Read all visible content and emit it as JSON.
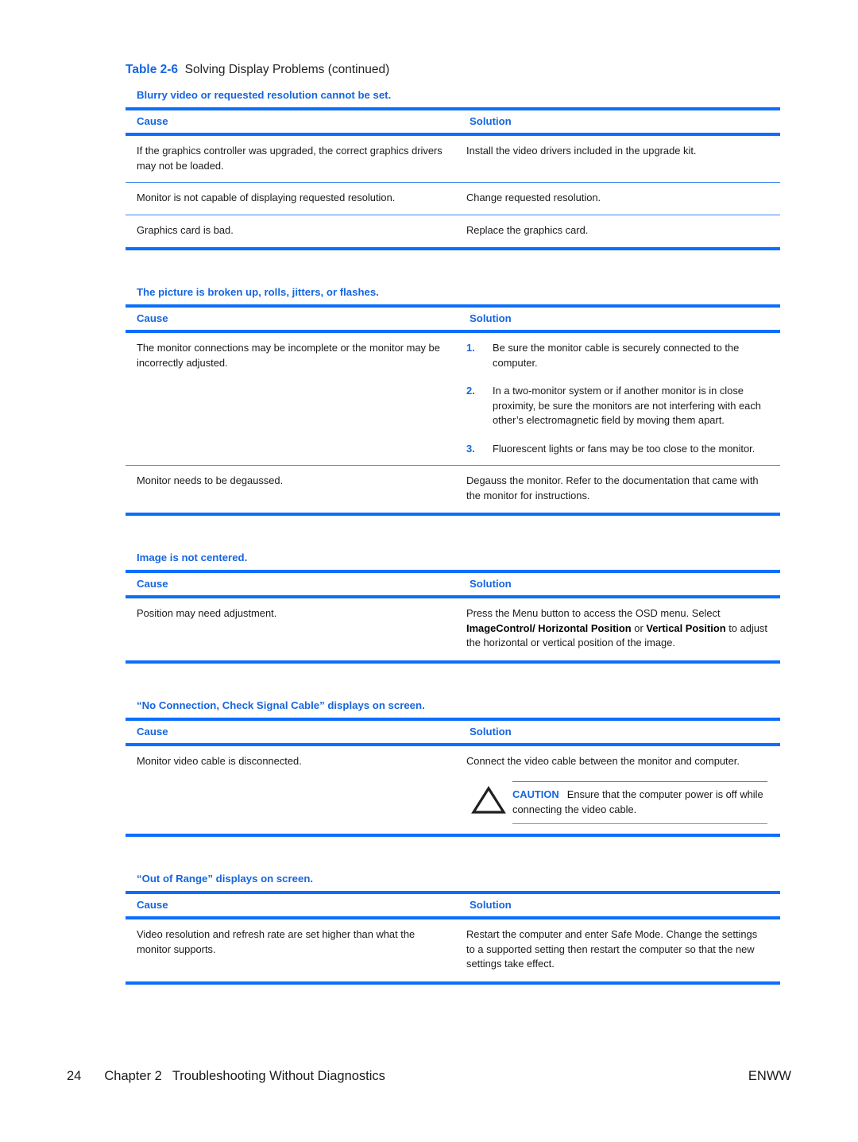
{
  "document": {
    "table_caption": {
      "number": "Table 2-6",
      "text": "Solving Display Problems (continued)"
    },
    "column_headers": {
      "cause": "Cause",
      "solution": "Solution"
    },
    "sections": [
      {
        "title": "Blurry video or requested resolution cannot be set.",
        "rows": [
          {
            "cause": "If the graphics controller was upgraded, the correct graphics drivers may not be loaded.",
            "solution": "Install the video drivers included in the upgrade kit."
          },
          {
            "cause": "Monitor is not capable of displaying requested resolution.",
            "solution": "Change requested resolution."
          },
          {
            "cause": "Graphics card is bad.",
            "solution": "Replace the graphics card."
          }
        ]
      },
      {
        "title": "The picture is broken up, rolls, jitters, or flashes.",
        "rows": [
          {
            "cause": "The monitor connections may be incomplete or the monitor may be incorrectly adjusted.",
            "solution_steps": [
              {
                "num": "1.",
                "text": "Be sure the monitor cable is securely connected to the computer."
              },
              {
                "num": "2.",
                "text": "In a two-monitor system or if another monitor is in close proximity, be sure the monitors are not interfering with each other’s electromagnetic field by moving them apart."
              },
              {
                "num": "3.",
                "text": "Fluorescent lights or fans may be too close to the monitor."
              }
            ]
          },
          {
            "cause": "Monitor needs to be degaussed.",
            "solution": "Degauss the monitor. Refer to the documentation that came with the monitor for instructions."
          }
        ]
      },
      {
        "title": "Image is not centered.",
        "rows": [
          {
            "cause": "Position may need adjustment.",
            "solution_rich": {
              "pre": "Press the Menu button to access the OSD menu. Select ",
              "bold1": "ImageControl/ Horizontal Position",
              "mid": " or ",
              "bold2": "Vertical Position",
              "post": " to adjust the horizontal or vertical position of the image."
            }
          }
        ]
      },
      {
        "title": "“No Connection, Check Signal Cable” displays on screen.",
        "rows": [
          {
            "cause": "Monitor video cable is disconnected.",
            "solution": "Connect the video cable between the monitor and computer.",
            "caution": {
              "icon": "warning-triangle-icon",
              "label": "CAUTION",
              "text": "Ensure that the computer power is off while connecting the video cable."
            }
          }
        ]
      },
      {
        "title": "“Out of Range” displays on screen.",
        "rows": [
          {
            "cause": "Video resolution and refresh rate are set higher than what the monitor supports.",
            "solution": "Restart the computer and enter Safe Mode. Change the settings to a supported setting then restart the computer so that the new settings take effect."
          }
        ]
      }
    ],
    "footer": {
      "page_number": "24",
      "chapter": "Chapter 2",
      "chapter_title": "Troubleshooting Without Diagnostics",
      "right_label": "ENWW"
    },
    "colors": {
      "accent_blue": "#0d6efd",
      "heading_blue": "#1566e0",
      "rule_blue": "#3b85f0",
      "text": "#1a1a1a"
    }
  }
}
